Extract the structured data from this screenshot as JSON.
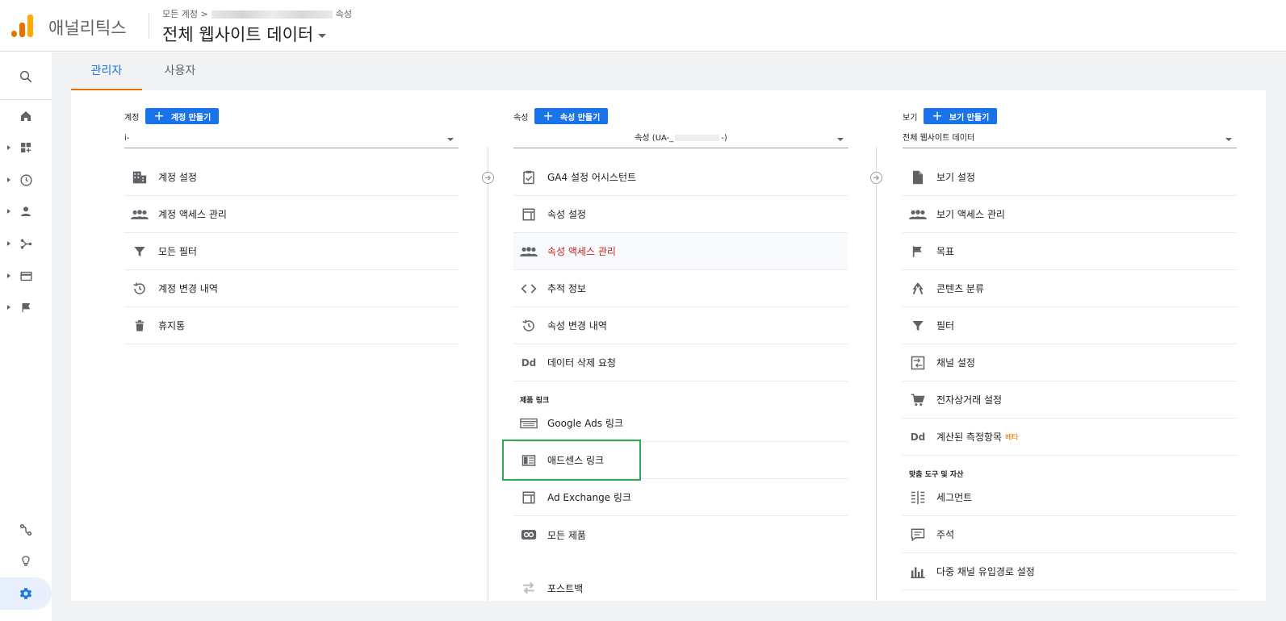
{
  "header": {
    "app_name": "애널리틱스",
    "breadcrumb_prefix": "모든 계정 >",
    "breadcrumb_suffix": "속성",
    "view_title": "전체 웹사이트 데이터"
  },
  "tabs": [
    {
      "label": "관리자",
      "active": true
    },
    {
      "label": "사용자",
      "active": false
    }
  ],
  "account_column": {
    "label": "계정",
    "create_button": "계정 만들기",
    "selected": "i-",
    "items": [
      {
        "label": "계정 설정",
        "icon": "building-icon"
      },
      {
        "label": "계정 액세스 관리",
        "icon": "people-icon"
      },
      {
        "label": "모든 필터",
        "icon": "filter-icon"
      },
      {
        "label": "계정 변경 내역",
        "icon": "history-icon"
      },
      {
        "label": "휴지통",
        "icon": "trash-icon"
      }
    ]
  },
  "property_column": {
    "label": "속성",
    "create_button": "속성 만들기",
    "selected_prefix": "속성 (UA-_",
    "selected_suffix": "-)",
    "items": [
      {
        "label": "GA4 설정 어시스턴트",
        "icon": "checklist-icon"
      },
      {
        "label": "속성 설정",
        "icon": "layout-icon"
      },
      {
        "label": "속성 액세스 관리",
        "icon": "people-icon"
      },
      {
        "label": "추적 정보",
        "icon": "code-icon"
      },
      {
        "label": "속성 변경 내역",
        "icon": "history-icon"
      },
      {
        "label": "데이터 삭제 요청",
        "icon": "dd-icon",
        "icon_text": "Dd"
      }
    ],
    "product_links_label": "제품 링크",
    "product_links": [
      {
        "label": "Google Ads 링크",
        "icon": "ads-icon"
      },
      {
        "label": "애드센스 링크",
        "icon": "adsense-icon"
      },
      {
        "label": "Ad Exchange 링크",
        "icon": "layout-icon"
      },
      {
        "label": "모든 제품",
        "icon": "link-icon"
      },
      {
        "label": "포스트백",
        "icon": "postback-icon"
      }
    ]
  },
  "view_column": {
    "label": "보기",
    "create_button": "보기 만들기",
    "selected": "전체 웹사이트 데이터",
    "items": [
      {
        "label": "보기 설정",
        "icon": "document-icon"
      },
      {
        "label": "보기 액세스 관리",
        "icon": "people-icon"
      },
      {
        "label": "목표",
        "icon": "flag-icon"
      },
      {
        "label": "콘텐츠 분류",
        "icon": "person-walk-icon"
      },
      {
        "label": "필터",
        "icon": "filter-icon"
      },
      {
        "label": "채널 설정",
        "icon": "channel-icon"
      },
      {
        "label": "전자상거래 설정",
        "icon": "cart-icon"
      },
      {
        "label": "계산된 측정항목",
        "icon": "dd-icon",
        "icon_text": "Dd",
        "badge": "베타"
      }
    ],
    "tools_label": "맞춤 도구 및 자산",
    "tools": [
      {
        "label": "세그먼트",
        "icon": "segment-icon"
      },
      {
        "label": "주석",
        "icon": "comment-icon"
      },
      {
        "label": "다중 채널 유입경로 설정",
        "icon": "bars-icon"
      }
    ]
  },
  "colors": {
    "accent": "#1a73e8",
    "tab_underline": "#e37400",
    "highlight_border": "#34a853",
    "hover_text": "#c5221f"
  }
}
